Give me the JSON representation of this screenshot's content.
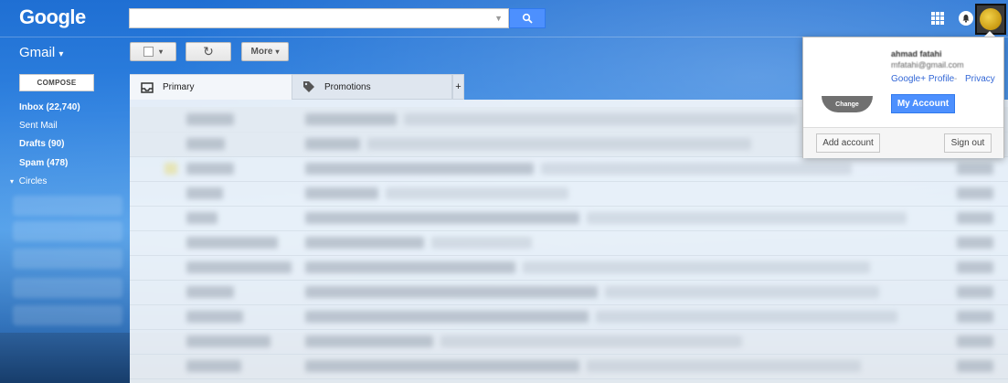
{
  "header": {
    "logo": "Google",
    "search_value": "",
    "app_label": "Gmail",
    "app_caret": "▾"
  },
  "toolbar": {
    "select_caret": "▾",
    "refresh_icon": "↻",
    "more_label": "More",
    "more_caret": "▾"
  },
  "sidebar": {
    "compose_label": "COMPOSE",
    "items": [
      {
        "label": "Inbox (22,740)",
        "bold": true
      },
      {
        "label": "Sent Mail",
        "bold": false
      },
      {
        "label": "Drafts (90)",
        "bold": true
      },
      {
        "label": "Spam (478)",
        "bold": true
      }
    ],
    "circles_label": "Circles",
    "circles_caret": "▾"
  },
  "tabs": [
    {
      "label": "Primary",
      "icon": "inbox-icon"
    },
    {
      "label": "Promotions",
      "icon": "tag-icon"
    },
    {
      "label": "+",
      "icon": "add-tab-icon"
    }
  ],
  "account_popup": {
    "name": "ahmad fatahi",
    "email": "mfatahi@gmail.com",
    "change_label": "Change",
    "profile_link": "Google+ Profile",
    "separator": "-",
    "privacy_link": "Privacy",
    "my_account_label": "My Account",
    "add_account_label": "Add account",
    "sign_out_label": "Sign out"
  },
  "colors": {
    "accent": "#4d90fe",
    "link": "#3367d6",
    "background": "#2f82e0"
  }
}
